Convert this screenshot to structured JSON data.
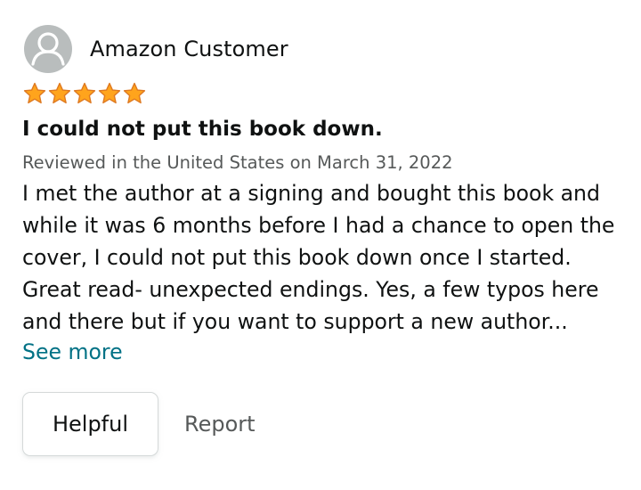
{
  "review": {
    "profile_name": "Amazon Customer",
    "avatar_icon": "user-silhouette-icon",
    "rating": 5,
    "rating_max": 5,
    "star_color": "#ffa41c",
    "star_outline_color": "#de7921",
    "title": "I could not put this book down.",
    "meta": "Reviewed in the United States on March 31, 2022",
    "body_lines": [
      "I met the author at a signing and bought this book and",
      "while it was 6 months before I had a chance to open the",
      "cover, I could not put this book down once I started.",
      "Great read- unexpected endings. Yes, a few typos here",
      "and there but if you want to support a new author..."
    ],
    "see_more_label": "See more",
    "helpful_label": "Helpful",
    "report_label": "Report",
    "link_color": "#007185"
  }
}
